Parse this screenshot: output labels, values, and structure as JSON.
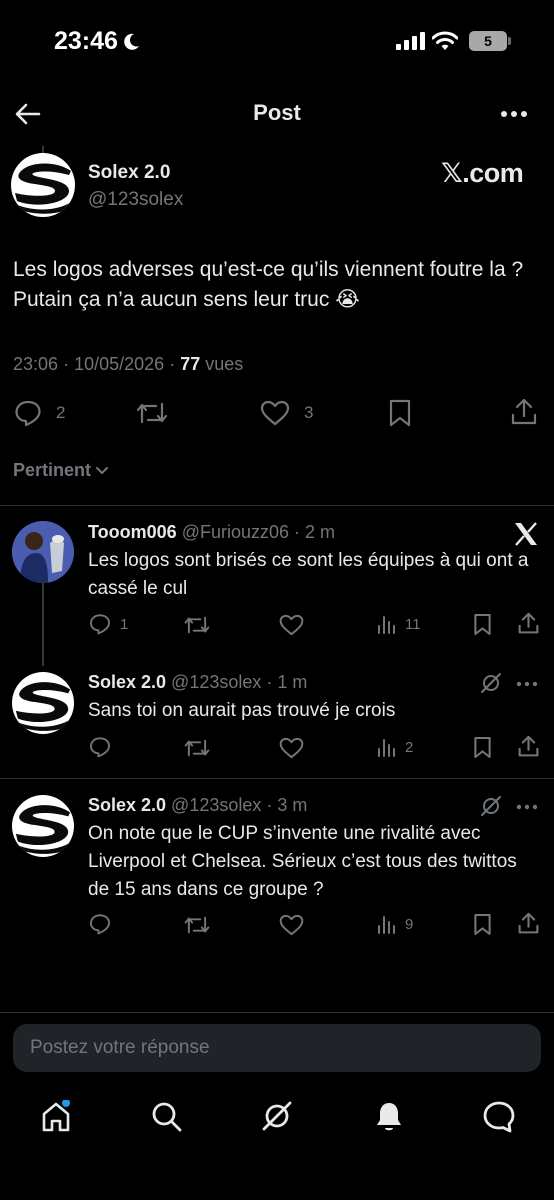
{
  "status_bar": {
    "time": "23:46",
    "battery": "5"
  },
  "header": {
    "title": "Post"
  },
  "post": {
    "author_name": "Solex 2.0",
    "author_handle": "@123solex",
    "source_label": "𝕏.com",
    "text": "Les logos adverses qu’est-ce qu’ils viennent foutre la ? Putain ça n’a aucun sens leur truc 😭",
    "time": "23:06",
    "date": "10/05/2026",
    "views_count": "77",
    "views_label": "vues",
    "replies": "2",
    "likes": "3"
  },
  "sort": {
    "label": "Pertinent"
  },
  "replies": [
    {
      "name": "Tooom006",
      "handle": "@Furiouzz06",
      "time": "2 m",
      "text": "Les logos sont brisés ce sont les équipes à qui ont a cassé le cul",
      "replies": "1",
      "views": "11"
    },
    {
      "name": "Solex 2.0",
      "handle": "@123solex",
      "time": "1 m",
      "text": "Sans toi on aurait pas trouvé je crois",
      "views": "2"
    },
    {
      "name": "Solex 2.0",
      "handle": "@123solex",
      "time": "3 m",
      "text": "On note que le CUP s’invente une rivalité avec Liverpool et Chelsea. Sérieux c’est tous des twittos de 15 ans dans ce groupe ?",
      "views": "9"
    }
  ],
  "composer": {
    "placeholder": "Postez votre réponse"
  },
  "separator": "·",
  "icons": {
    "back": "back-arrow-icon",
    "more": "more-icon",
    "reply": "reply-icon",
    "repost": "repost-icon",
    "like": "like-icon",
    "bookmark": "bookmark-icon",
    "share": "share-icon",
    "views": "views-icon",
    "grok": "grok-icon",
    "home": "home-icon",
    "search": "search-icon",
    "notifications": "bell-icon",
    "messages": "messages-icon"
  },
  "colors": {
    "background": "#000000",
    "text": "#e7e9ea",
    "muted": "#71767b",
    "accent": "#1d9bf0"
  }
}
